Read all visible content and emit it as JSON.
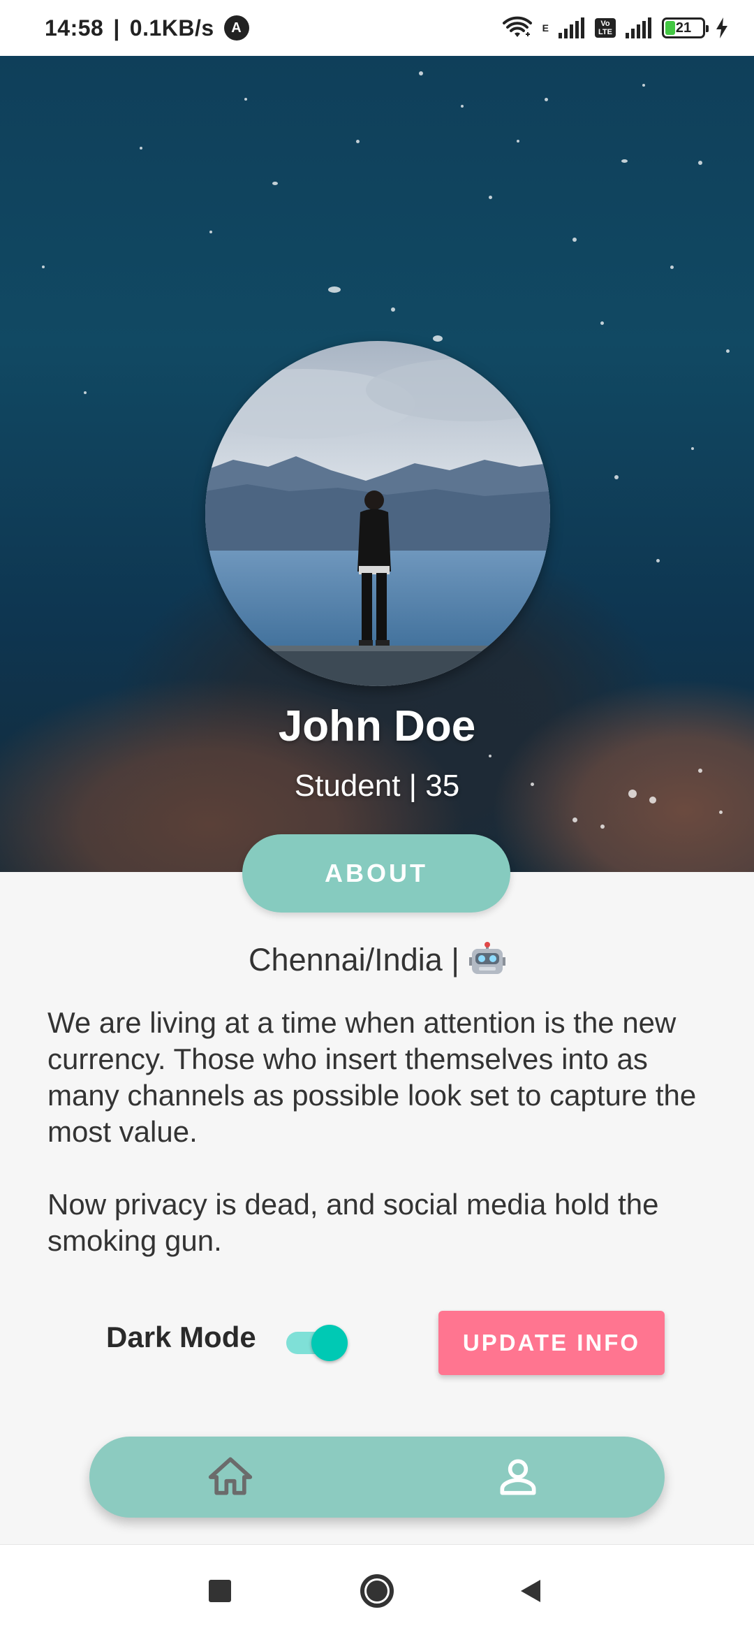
{
  "status_bar": {
    "time": "14:58",
    "separator": "|",
    "speed": "0.1KB/s",
    "auto_icon_glyph": "A",
    "network_label": "E",
    "volte_top": "Vo",
    "volte_bottom": "LTE",
    "battery_level": "21",
    "icons": [
      "wifi-icon",
      "signal-icon",
      "volte-icon",
      "signal-icon",
      "battery-icon",
      "charging-icon"
    ]
  },
  "profile": {
    "name": "John Doe",
    "subtitle": "Student | 35",
    "about_label": "ABOUT",
    "location": "Chennai/India |",
    "location_icon": "robot-icon",
    "bio_paragraphs": [
      "We are living at a time when attention is the new currency. Those who insert themselves into as many channels as possible look set to capture the most value.",
      "Now privacy is dead, and social media hold the smoking gun."
    ]
  },
  "settings": {
    "dark_mode_label": "Dark Mode",
    "dark_mode_on": true,
    "update_label": "UPDATE INFO"
  },
  "bottom_nav": {
    "items": [
      "home-icon",
      "profile-icon"
    ]
  },
  "system_nav": {
    "items": [
      "recents-square-icon",
      "home-circle-icon",
      "back-triangle-icon"
    ]
  },
  "colors": {
    "accent_teal": "#86cbbf",
    "update_pink": "#ff7590",
    "toggle_thumb": "#00c9b4",
    "toggle_track": "#7fe0d7",
    "background": "#f6f6f6"
  }
}
